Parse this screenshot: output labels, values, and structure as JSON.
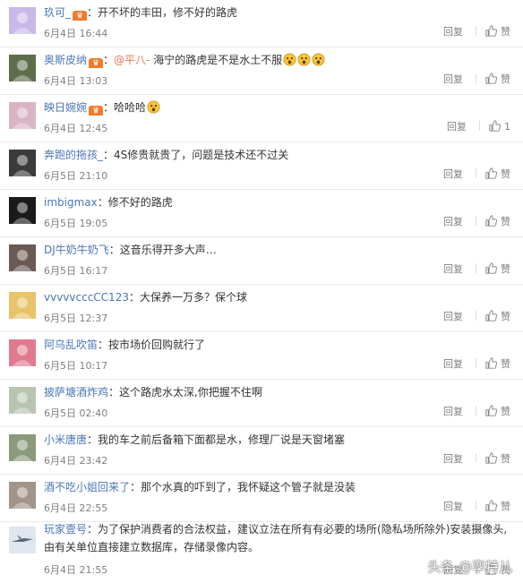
{
  "ui": {
    "reply_label": "回复",
    "like_label": "赞"
  },
  "comments": [
    {
      "username": "玖可_",
      "badge": "vip",
      "separator": "：",
      "mention": "",
      "text": "开不坏的丰田，修不好的路虎",
      "emoji_count": 0,
      "date": "6月4日 16:44",
      "likes": "赞"
    },
    {
      "username": "奥斯皮纳",
      "badge": "vip",
      "separator": "：",
      "mention": "@平八-",
      "text": " 海宁的路虎是不是水土不服",
      "emoji_count": 3,
      "date": "6月4日 13:03",
      "likes": "赞"
    },
    {
      "username": "映日婉婉",
      "badge": "vip",
      "separator": "：",
      "mention": "",
      "text": "哈哈哈",
      "emoji_count": 1,
      "date": "6月4日 12:45",
      "likes": "1"
    },
    {
      "username": "奔跑的拖孩_",
      "badge": "",
      "separator": "：",
      "mention": "",
      "text": "4S修贵就贵了，问题是技术还不过关",
      "emoji_count": 0,
      "date": "6月5日 21:10",
      "likes": "赞"
    },
    {
      "username": "imbigmax",
      "badge": "",
      "separator": "：",
      "mention": "",
      "text": "修不好的路虎",
      "emoji_count": 0,
      "date": "6月5日 19:05",
      "likes": "赞"
    },
    {
      "username": "DJ牛奶牛奶飞",
      "badge": "",
      "separator": "：",
      "mention": "",
      "text": "这音乐得开多大声…",
      "emoji_count": 0,
      "date": "6月5日 16:17",
      "likes": "赞"
    },
    {
      "username": "vvvvvcccCC123",
      "badge": "",
      "separator": "：",
      "mention": "",
      "text": "大保养一万多？保个球",
      "emoji_count": 0,
      "date": "6月5日 12:37",
      "likes": "赞"
    },
    {
      "username": "阿乌乱吹笛",
      "badge": "",
      "separator": "：",
      "mention": "",
      "text": "按市场价回购就行了",
      "emoji_count": 0,
      "date": "6月5日 10:17",
      "likes": "赞"
    },
    {
      "username": "披萨塘酒炸鸡",
      "badge": "",
      "separator": "：",
      "mention": "",
      "text": "这个路虎水太深,你把握不住啊",
      "emoji_count": 0,
      "date": "6月5日 02:40",
      "likes": "赞"
    },
    {
      "username": "小米唐唐",
      "badge": "",
      "separator": "：",
      "mention": "",
      "text": "我的车之前后备箱下面都是水，修理厂说是天窗堵塞",
      "emoji_count": 0,
      "date": "6月4日 23:42",
      "likes": "赞"
    },
    {
      "username": "酒不吃小姐回来了",
      "badge": "",
      "separator": "：",
      "mention": "",
      "text": "那个水真的吓到了，我怀疑这个管子就是没装",
      "emoji_count": 0,
      "date": "6月4日 22:55",
      "likes": "赞"
    }
  ],
  "last_comment": {
    "username": "玩家壹号",
    "separator": "：",
    "text": "为了保护消费者的合法权益，建议立法在所有有必要的场所(隐私场所除外)安装摄像头,由有关单位直接建立数据库，存储录像内容。",
    "date": "6月4日 21:55",
    "likes": "赞"
  },
  "watermark": "头条 @孪特儿",
  "colors": {
    "username": "#eb7350",
    "username_blue": "#4a76b8",
    "meta": "#808080",
    "badge": "#f07c2d"
  },
  "icons": {
    "like": "thumbs-up-icon",
    "badge": "vip-badge-icon",
    "emoji": "surprised-emoji-icon"
  }
}
